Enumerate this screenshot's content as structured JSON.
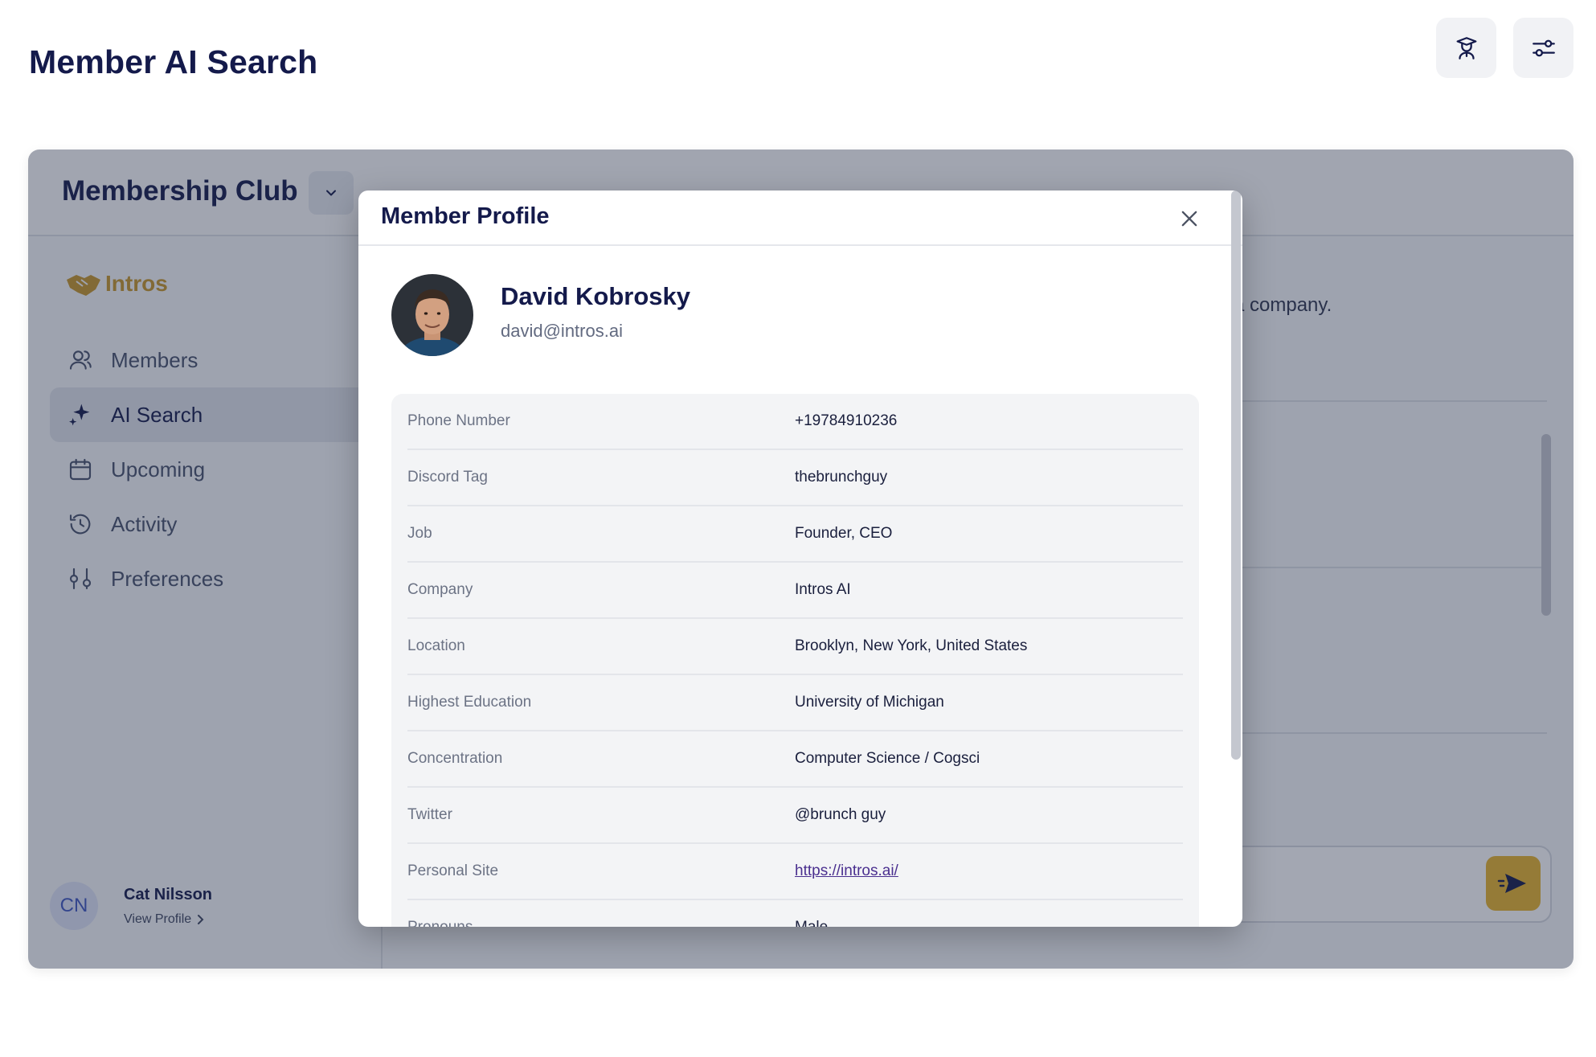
{
  "page": {
    "title": "Member AI Search"
  },
  "top_actions": [
    {
      "icon": "graduate-icon"
    },
    {
      "icon": "sliders-icon"
    }
  ],
  "header": {
    "club_name": "Membership Club"
  },
  "sidebar": {
    "brand": "Intros",
    "items": [
      {
        "label": "Members",
        "icon": "users-icon"
      },
      {
        "label": "AI Search",
        "icon": "sparkle-icon",
        "active": true
      },
      {
        "label": "Upcoming",
        "icon": "calendar-icon"
      },
      {
        "label": "Activity",
        "icon": "history-icon"
      },
      {
        "label": "Preferences",
        "icon": "preferences-icon"
      }
    ],
    "user": {
      "initials": "CN",
      "name": "Cat Nilsson",
      "link": "View Profile"
    }
  },
  "main": {
    "partial_text": "a company."
  },
  "modal": {
    "title": "Member Profile",
    "profile": {
      "name": "David Kobrosky",
      "email": "david@intros.ai"
    },
    "fields": [
      {
        "label": "Phone Number",
        "value": "+19784910236"
      },
      {
        "label": "Discord Tag",
        "value": "thebrunchguy"
      },
      {
        "label": "Job",
        "value": "Founder, CEO"
      },
      {
        "label": "Company",
        "value": "Intros AI"
      },
      {
        "label": "Location",
        "value": "Brooklyn, New York, United States"
      },
      {
        "label": "Highest Education",
        "value": "University of Michigan"
      },
      {
        "label": "Concentration",
        "value": "Computer Science / Cogsci"
      },
      {
        "label": "Twitter",
        "value": "@brunch guy"
      },
      {
        "label": "Personal Site",
        "value": "https://intros.ai/"
      },
      {
        "label": "Pronouns",
        "value": "Male"
      }
    ]
  },
  "colors": {
    "brand": "#c7962a",
    "send": "#e7b42c",
    "title": "#141a4b"
  }
}
